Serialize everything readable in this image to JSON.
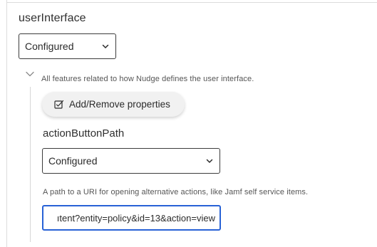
{
  "section": {
    "title": "userInterface",
    "select_value": "Configured",
    "description": "All features related to how Nudge defines the user interface."
  },
  "properties_button": {
    "label": "Add/Remove properties",
    "icon": "checkbox-edit-icon"
  },
  "field": {
    "title": "actionButtonPath",
    "select_value": "Configured",
    "description": "A path to a URI for opening alternative actions, like Jamf self service items.",
    "input_value": "ıtent?entity=policy&id=13&action=view"
  },
  "icons": {
    "collapse": "chevron-down-icon",
    "select_arrow": "chevron-down-icon"
  },
  "colors": {
    "focus_border": "#2862d6",
    "border": "#3c3c3c"
  }
}
